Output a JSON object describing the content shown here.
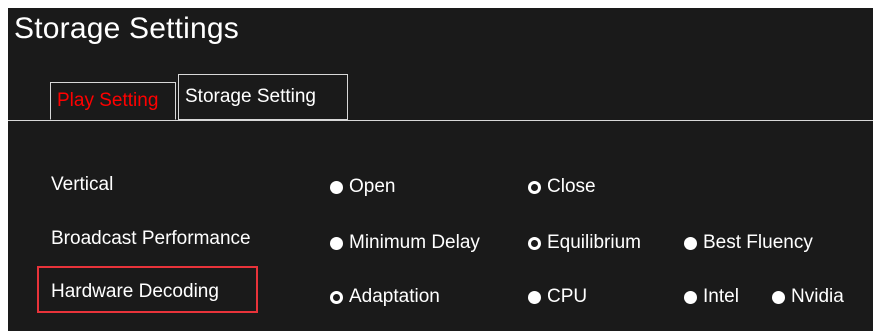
{
  "window": {
    "title": "Storage Settings"
  },
  "tabs": [
    {
      "label": "Play Setting",
      "active": true
    },
    {
      "label": "Storage Setting",
      "active": false
    }
  ],
  "settings": [
    {
      "label": "Vertical",
      "options": [
        {
          "label": "Open",
          "selected": false
        },
        {
          "label": "Close",
          "selected": true
        }
      ]
    },
    {
      "label": "Broadcast Performance",
      "options": [
        {
          "label": "Minimum Delay",
          "selected": false
        },
        {
          "label": "Equilibrium",
          "selected": true
        },
        {
          "label": "Best Fluency",
          "selected": false
        }
      ]
    },
    {
      "label": "Hardware Decoding",
      "highlighted": true,
      "options": [
        {
          "label": "Adaptation",
          "selected": true
        },
        {
          "label": "CPU",
          "selected": false
        },
        {
          "label": "Intel",
          "selected": false
        },
        {
          "label": "Nvidia",
          "selected": false
        }
      ]
    }
  ],
  "colors": {
    "background": "#1a1a1a",
    "active_tab_text": "#ff0000",
    "highlight_border": "#e8333a"
  }
}
